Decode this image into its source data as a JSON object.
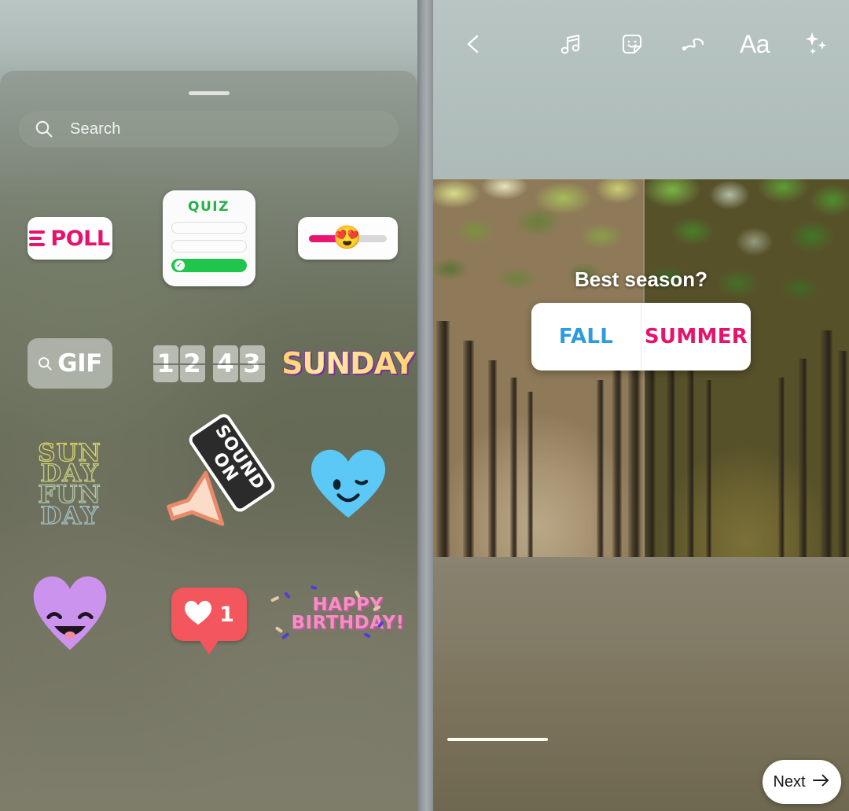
{
  "sticker_tray": {
    "search": {
      "placeholder": "Search",
      "icon": "search-icon"
    },
    "grabber": "drag-handle",
    "stickers": [
      [
        {
          "id": "poll",
          "name": "poll-sticker",
          "label": "POLL",
          "accent": "#e5136c"
        },
        {
          "id": "quiz",
          "name": "quiz-sticker",
          "label": "QUIZ",
          "accent": "#23b24b"
        },
        {
          "id": "slider",
          "name": "emoji-slider-sticker",
          "label": "",
          "emoji": "😍",
          "accent": "#e5136c"
        }
      ],
      [
        {
          "id": "gif",
          "name": "gif-sticker",
          "label": "GIF",
          "accent": "#ffffff"
        },
        {
          "id": "clock",
          "name": "clock-sticker",
          "label": "1243",
          "digits": [
            "1",
            "2",
            "4",
            "3"
          ]
        },
        {
          "id": "sunday",
          "name": "sunday-text-sticker",
          "label": "SUNDAY",
          "accent": "#ffd874"
        }
      ],
      [
        {
          "id": "sundayfunday",
          "name": "sunday-fun-day-sticker",
          "lines": [
            "SUN",
            "DAY",
            "FUN",
            "DAY"
          ]
        },
        {
          "id": "soundon",
          "name": "sound-on-sticker",
          "lines": [
            "SOUND",
            "ON"
          ]
        },
        {
          "id": "blueheart",
          "name": "winking-blue-heart-sticker",
          "accent": "#5bc8f5"
        }
      ],
      [
        {
          "id": "purpleheart",
          "name": "smiling-purple-heart-sticker",
          "accent": "#cb93ed"
        },
        {
          "id": "like",
          "name": "like-bubble-sticker",
          "count": "1",
          "accent": "#f4565d"
        },
        {
          "id": "birthday",
          "name": "happy-birthday-sticker",
          "lines": [
            "HAPPY",
            "BIRTHDAY!"
          ],
          "accent": "#f48fc4"
        }
      ]
    ]
  },
  "editor": {
    "toolbar": {
      "back": "back-chevron-icon",
      "items": [
        {
          "name": "music-icon",
          "label": "Music"
        },
        {
          "name": "sticker-icon",
          "label": "Stickers"
        },
        {
          "name": "draw-icon",
          "label": "Draw"
        },
        {
          "name": "text-icon",
          "label": "Aa"
        },
        {
          "name": "effects-icon",
          "label": "Effects"
        }
      ]
    },
    "poll": {
      "question": "Best season?",
      "options": [
        {
          "label": "FALL",
          "color": "#2e9bde"
        },
        {
          "label": "SUMMER",
          "color": "#e5136c"
        }
      ]
    },
    "next_button": {
      "label": "Next",
      "icon": "arrow-right-icon"
    }
  }
}
